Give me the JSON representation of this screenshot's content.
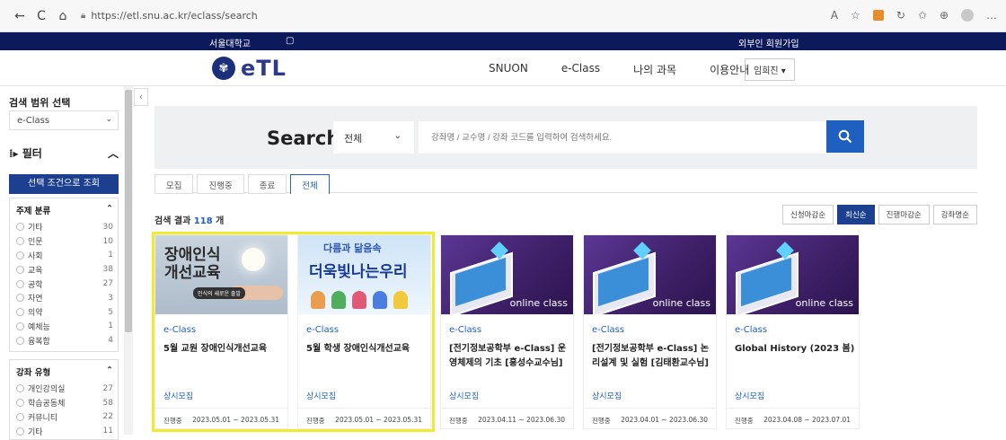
{
  "browser": {
    "url": "https://etl.snu.ac.kr/eclass/search",
    "nav_back": "←",
    "nav_reload": "C",
    "nav_home": "⌂"
  },
  "topbar": {
    "university": "서울대학교",
    "signup": "외부인 회원가입"
  },
  "header": {
    "logo_text": "eTL",
    "nav": [
      "SNUON",
      "e-Class",
      "나의 과목",
      "이용안내"
    ],
    "user_menu": "임희진 ▾"
  },
  "sidebar": {
    "scope_title": "검색 범위 선택",
    "scope_value": "e-Class",
    "filter_title": "필터",
    "apply_button": "선택 조건으로 조회",
    "subject_group": {
      "title": "주제 분류",
      "items": [
        {
          "label": "기타",
          "count": "30"
        },
        {
          "label": "인문",
          "count": "10"
        },
        {
          "label": "사회",
          "count": "1"
        },
        {
          "label": "교육",
          "count": "38"
        },
        {
          "label": "공학",
          "count": "27"
        },
        {
          "label": "자연",
          "count": "3"
        },
        {
          "label": "의약",
          "count": "5"
        },
        {
          "label": "예체능",
          "count": "1"
        },
        {
          "label": "융복합",
          "count": "4"
        }
      ]
    },
    "type_group": {
      "title": "강좌 유형",
      "items": [
        {
          "label": "개인강의실",
          "count": "27"
        },
        {
          "label": "학습공동체",
          "count": "58"
        },
        {
          "label": "커뮤니티",
          "count": "22"
        },
        {
          "label": "기타",
          "count": "11"
        }
      ]
    }
  },
  "search": {
    "label": "Search",
    "scope": "전체",
    "placeholder": "강좌명 / 교수명 / 강좌 코드를 입력하여 검색하세요."
  },
  "tabs": [
    "모집",
    "진행중",
    "종료",
    "전체"
  ],
  "active_tab": "전체",
  "results": {
    "prefix": "검색 결과",
    "count": "118",
    "suffix": "개"
  },
  "sorts": [
    {
      "label": "신청마감순",
      "active": false
    },
    {
      "label": "최신순",
      "active": true
    },
    {
      "label": "진행마감순",
      "active": false
    },
    {
      "label": "강좌명순",
      "active": false
    }
  ],
  "cards": [
    {
      "category": "e-Class",
      "title": "5월 교원 장애인식개선교육",
      "status": "상시모집",
      "phase": "진행중",
      "dates": "2023.05.01 ~ 2023.05.31",
      "image": {
        "line1": "장애인식",
        "line2": "개선교육",
        "pill": "인식의 새로운 출발"
      }
    },
    {
      "category": "e-Class",
      "title": "5월 학생 장애인식개선교육",
      "status": "상시모집",
      "phase": "진행중",
      "dates": "2023.05.01 ~ 2023.05.31",
      "image": {
        "sub": "다름과 닮음속",
        "big": "더욱빛나는우리"
      }
    },
    {
      "category": "e-Class",
      "title": "[전기정보공학부 e-Class] 운영체제의 기초 [홍성수교수님]",
      "status": "상시모집",
      "phase": "진행중",
      "dates": "2023.04.11 ~ 2023.06.30",
      "image": {
        "caption": "online class"
      }
    },
    {
      "category": "e-Class",
      "title": "[전기정보공학부 e-Class] 논리설계 및 실험 [김태환교수님]",
      "status": "상시모집",
      "phase": "진행중",
      "dates": "2023.04.01 ~ 2023.06.30",
      "image": {
        "caption": "online class"
      }
    },
    {
      "category": "e-Class",
      "title": "Global History (2023 봄)",
      "status": "상시모집",
      "phase": "진행중",
      "dates": "2023.04.08 ~ 2023.07.01",
      "image": {
        "caption": "online class"
      }
    }
  ]
}
